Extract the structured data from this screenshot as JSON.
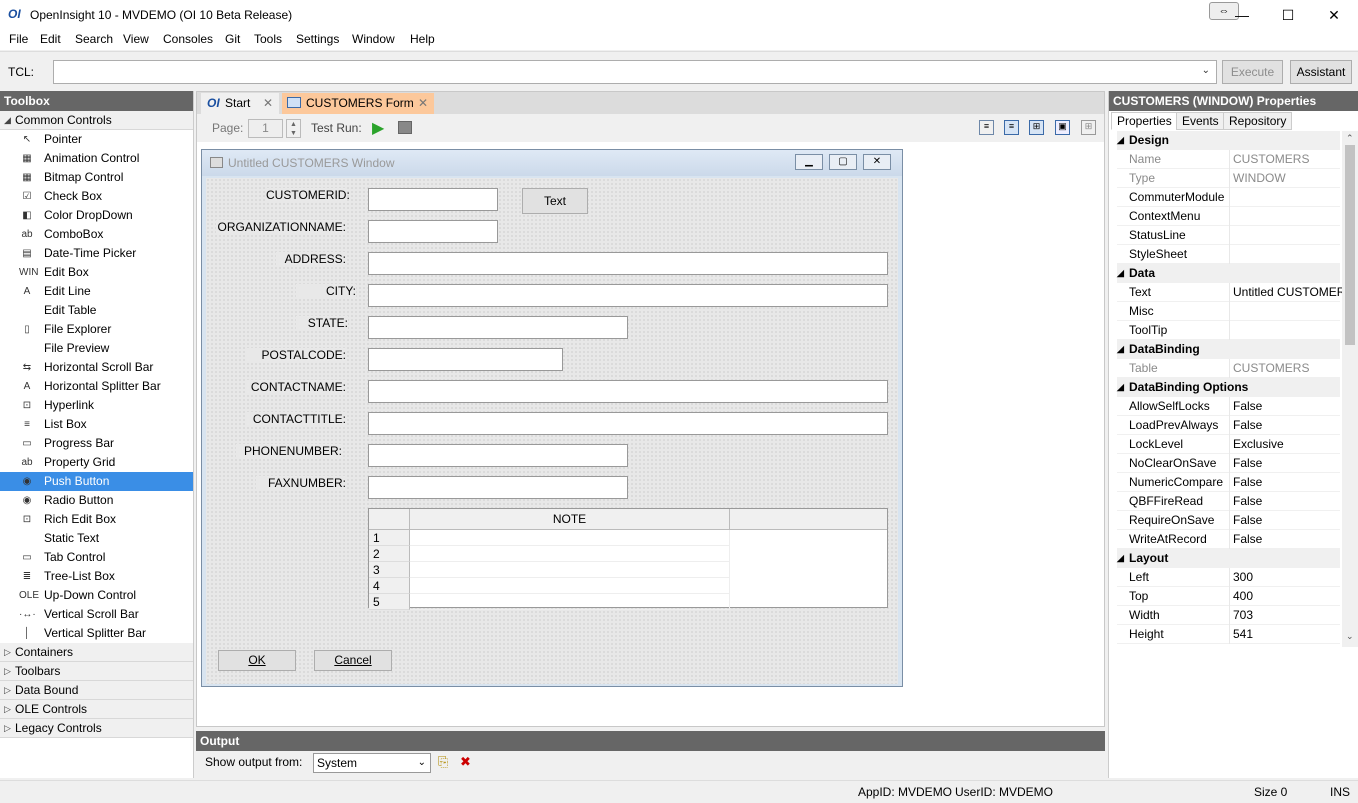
{
  "window": {
    "title": "OpenInsight 10 - MVDEMO (OI 10 Beta Release)",
    "app_icon": "OI"
  },
  "menu": [
    "File",
    "Edit",
    "Search",
    "View",
    "Consoles",
    "Git",
    "Tools",
    "Settings",
    "Window",
    "Help"
  ],
  "tcl": {
    "label": "TCL:",
    "execute": "Execute",
    "assistant": "Assistant"
  },
  "toolbox": {
    "header": "Toolbox",
    "common": "Common Controls",
    "items": [
      "Pointer",
      "Animation Control",
      "Bitmap Control",
      "Check Box",
      "Color DropDown",
      "ComboBox",
      "Date-Time Picker",
      "Edit Box",
      "Edit Line",
      "Edit Table",
      "File Explorer",
      "File Preview",
      "Horizontal Scroll Bar",
      "Horizontal Splitter Bar",
      "Hyperlink",
      "List Box",
      "Progress Bar",
      "Property Grid",
      "Push Button",
      "Radio Button",
      "Rich Edit Box",
      "Static Text",
      "Tab Control",
      "Tree-List Box",
      "Up-Down Control",
      "Vertical Scroll Bar",
      "Vertical Splitter Bar"
    ],
    "sections": [
      "Containers",
      "Toolbars",
      "Data Bound",
      "OLE Controls",
      "Legacy Controls"
    ]
  },
  "tabs": {
    "start": "Start",
    "form": "CUSTOMERS Form"
  },
  "subtool": {
    "page_label": "Page:",
    "page_value": "1",
    "test_run": "Test Run:"
  },
  "designer": {
    "title": "Untitled CUSTOMERS Window",
    "text_button": "Text",
    "labels": [
      "CUSTOMERID:",
      "ORGANIZATIONNAME:",
      "ADDRESS:",
      "CITY:",
      "STATE:",
      "POSTALCODE:",
      "CONTACTNAME:",
      "CONTACTTITLE:",
      "PHONENUMBER:",
      "FAXNUMBER:"
    ],
    "note_header": "NOTE",
    "rows": [
      "1",
      "2",
      "3",
      "4",
      "5"
    ],
    "ok": "OK",
    "cancel": "Cancel"
  },
  "properties": {
    "header": "CUSTOMERS (WINDOW) Properties",
    "tabs": [
      "Properties",
      "Events",
      "Repository"
    ],
    "design": "Design",
    "design_rows": [
      [
        "Name",
        "CUSTOMERS"
      ],
      [
        "Type",
        "WINDOW"
      ],
      [
        "CommuterModule",
        ""
      ],
      [
        "ContextMenu",
        ""
      ],
      [
        "StatusLine",
        ""
      ],
      [
        "StyleSheet",
        ""
      ]
    ],
    "data": "Data",
    "data_rows": [
      [
        "Text",
        "Untitled CUSTOMERS"
      ],
      [
        "Misc",
        ""
      ],
      [
        "ToolTip",
        ""
      ]
    ],
    "databinding": "DataBinding",
    "databinding_rows": [
      [
        "Table",
        "CUSTOMERS"
      ]
    ],
    "dbopts": "DataBinding Options",
    "dbopts_rows": [
      [
        "AllowSelfLocks",
        "False"
      ],
      [
        "LoadPrevAlways",
        "False"
      ],
      [
        "LockLevel",
        "Exclusive"
      ],
      [
        "NoClearOnSave",
        "False"
      ],
      [
        "NumericCompare",
        "False"
      ],
      [
        "QBFFireRead",
        "False"
      ],
      [
        "RequireOnSave",
        "False"
      ],
      [
        "WriteAtRecord",
        "False"
      ]
    ],
    "layout": "Layout",
    "layout_rows": [
      [
        "Left",
        "300"
      ],
      [
        "Top",
        "400"
      ],
      [
        "Width",
        "703"
      ],
      [
        "Height",
        "541"
      ]
    ]
  },
  "output": {
    "header": "Output",
    "show_label": "Show output from:",
    "source": "System"
  },
  "status": {
    "appid": "AppID: MVDEMO",
    "userid": "UserID: MVDEMO",
    "size": "Size 0",
    "ins": "INS"
  }
}
